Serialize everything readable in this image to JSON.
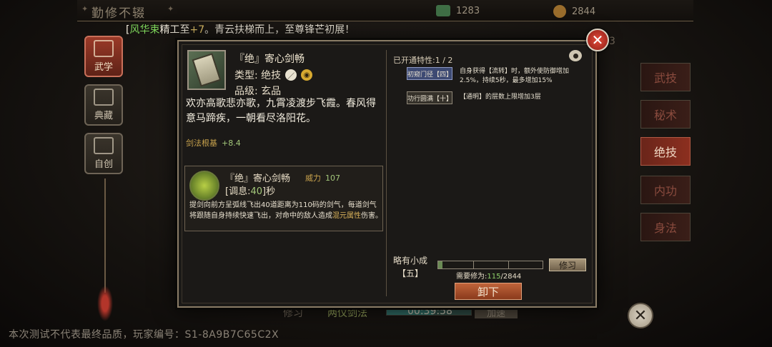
{
  "topbar": {
    "title": "勤修不辍",
    "res1": "1283",
    "res2": "2844"
  },
  "notice": {
    "prefix": "[",
    "name": "风华束",
    "mid": "精工至",
    "plus": "+7",
    "tail": "。青云扶梯而上，至尊锋芒初展！"
  },
  "left_tabs": [
    {
      "label": "武学",
      "active": true
    },
    {
      "label": "典藏",
      "active": false
    },
    {
      "label": "自创",
      "active": false
    }
  ],
  "right_tabs": [
    "武技",
    "秘术",
    "绝技",
    "内功",
    "身法"
  ],
  "right_active": "绝技",
  "behind": {
    "train": "修习",
    "skill2": "两仪剑法",
    "timer": "00:39:58",
    "speedup": "加速",
    "count": "3",
    "timer_progress": 0.55
  },
  "watermark": "本次测试不代表最终品质，玩家编号：S1-8A9B7C65C2X",
  "item": {
    "name": "『绝』寄心剑畅",
    "type_label": "类型: 绝技",
    "grade_label": "品级: 玄品",
    "description": "欢亦高歌悲亦歌，九霄凌渡步飞霞。春风得意马蹄疾，一朝看尽洛阳花。",
    "root_label": "剑法根基",
    "root_value": "+8.4"
  },
  "skill": {
    "name": "『绝』寄心剑畅",
    "power_label": "威力",
    "power_value": "107",
    "cooldown_prefix": "[调息:",
    "cooldown_value": "40",
    "cooldown_suffix": "]秒",
    "desc_a": "提剑向前方呈弧线飞出40道距离为110码的剑气，每道剑气将跟随自身持续快速飞出，对命中的敌人造成",
    "desc_hl": "混元属性",
    "desc_b": "伤害。"
  },
  "traits": {
    "header": "已开通特性:1 / 2",
    "list": [
      {
        "label": "初窥门径【四】",
        "desc": "自身获得【流转】时，额外使防御增加2.5%，持续5秒，最多增加15%",
        "active": true
      },
      {
        "label": "功行圆满【十】",
        "desc": "【通明】的层数上限增加3层",
        "active": false
      }
    ]
  },
  "progress": {
    "level_name": "略有小成",
    "level_num": "【五】",
    "req_label": "需要修为:",
    "current": "115",
    "sep": "/",
    "total": "2844",
    "fraction": 0.04
  },
  "buttons": {
    "train": "修习",
    "unload": "卸下"
  }
}
